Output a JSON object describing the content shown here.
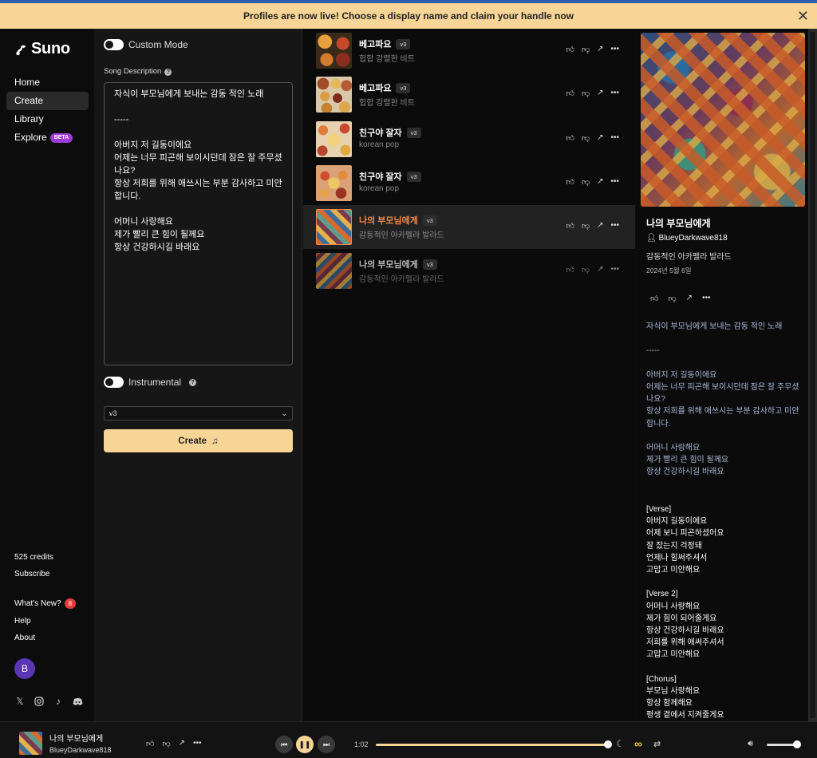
{
  "banner": {
    "text": "Profiles are now live! Choose a display name and claim your handle now",
    "close": "✕"
  },
  "sidebar": {
    "logo": "Suno",
    "nav": [
      {
        "label": "Home"
      },
      {
        "label": "Create"
      },
      {
        "label": "Library"
      },
      {
        "label": "Explore",
        "badge": "BETA"
      }
    ],
    "credits": "525 credits",
    "subscribe": "Subscribe",
    "whats_new": "What's New?",
    "whats_new_count": "8",
    "help": "Help",
    "about": "About",
    "avatar": "B"
  },
  "create_panel": {
    "custom_mode": "Custom Mode",
    "song_description_label": "Song Description",
    "song_description": "자식이 부모님에게 보내는 감동 적인 노래\n\n-----\n\n아버지 저 길동이에요\n어제는 너무 피곤해 보이시던데 잠은 잘 주무셨나요?\n항상 저희를 위해 애쓰시는 부분 감사하고 미안합니다.\n\n어머니 사랑해요\n제가 빨리 큰 힘이 될께요\n항상 건강하시길 바래요",
    "instrumental": "Instrumental",
    "version_select": "v3",
    "create_button": "Create"
  },
  "songs": [
    {
      "title": "베고파요",
      "version": "v3",
      "style": "힙합 강렬한 비트"
    },
    {
      "title": "베고파요",
      "version": "v3",
      "style": "힙합 강렬한 비트"
    },
    {
      "title": "친구야 잘자",
      "version": "v3",
      "style": "korean pop"
    },
    {
      "title": "친구야 잘자",
      "version": "v3",
      "style": "korean pop"
    },
    {
      "title": "나의 부모님에게",
      "version": "v3",
      "style": "감동적인 아카펠라 발라드"
    },
    {
      "title": "나의 부모님에게",
      "version": "v3",
      "style": "감동적인 아카펠라 발라드"
    }
  ],
  "detail": {
    "title": "나의 부모님에게",
    "user": "BlueyDarkwave818",
    "style": "감동적인 아카펠라 발라드",
    "date": "2024년 5월 6일",
    "prompt": "자식이 부모님에게 보내는 감동 적인 노래\n\n-----\n\n아버지 저 길동이에요\n어제는 너무 피곤해 보이시던데 잠은 잘 주무셨나요?\n항상 저희를 위해 애쓰시는 부분 감사하고 미안합니다.\n\n어머니 사랑해요\n제가 빨리 큰 힘이 될께요\n항상 건강하시길 바래요",
    "lyrics": "[Verse]\n아버지 길동이에요\n어제 보니 피곤하셨어요\n잘 잤는지 걱정돼\n언제나 힘써주셔서\n고맙고 미안해요\n\n[Verse 2]\n어머니 사랑해요\n제가 힘이 되어줄게요\n항상 건강하시길 바래요\n저희를 위해 애써주셔서\n고맙고 미안해요\n\n[Chorus]\n부모님 사랑해요\n항상 함께해요\n평생 곁에서 지켜줄게요"
  },
  "player": {
    "title": "나의 부모님에게",
    "user": "BlueyDarkwave818",
    "time": "1:02",
    "progress": 0.98,
    "volume": 0.9
  },
  "colors": {
    "accent": "#f7d596",
    "highlight": "#f4884a",
    "beta": "#a03ad6"
  }
}
